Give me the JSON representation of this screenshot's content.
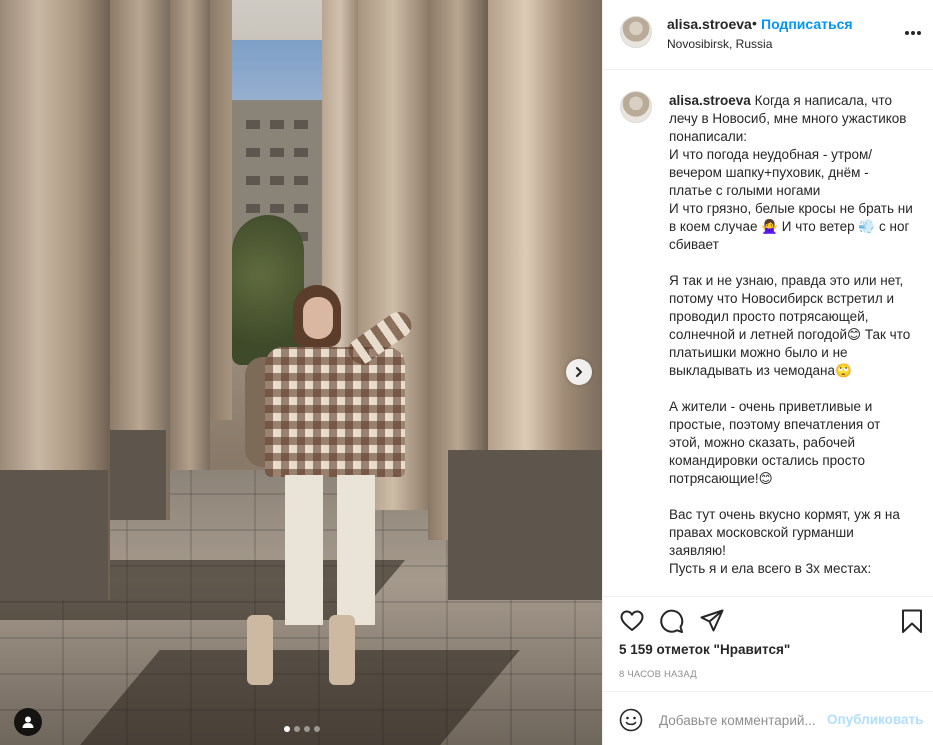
{
  "post": {
    "username": "alisa.stroeva",
    "separator": "•",
    "follow_label": "Подписаться",
    "location": "Novosibirsk, Russia",
    "more_icon": "more-horizontal-icon",
    "caption": {
      "username": "alisa.stroeva",
      "paragraphs": [
        "Когда я написала, что лечу в Новосиб, мне много ужастиков понаписали:",
        "И что погода неудобная - утром/вечером шапку+пуховик, днём - платье с голыми ногами",
        "И что грязно, белые кросы не брать ни в коем случае 🙅‍♀️ И что ветер 💨 с ног сбивает",
        "",
        "Я так и не узнаю, правда это или нет, потому что Новосибирск встретил и проводил просто потрясающей, солнечной и летней погодой😊 Так что платьишки можно было и не выкладывать из чемодана🙄",
        "",
        "А жители - очень приветливые и простые, поэтому впечатления от этой, можно сказать, рабочей командировки остались просто потрясающие!😊",
        "",
        "Вас тут очень вкусно кормят, уж я на правах московской гурманши заявляю!",
        "Пусть я и ела всего в 3х местах:"
      ]
    },
    "likes": "5 159 отметок \"Нравится\"",
    "time_ago": "8 ЧАСОВ НАЗАД",
    "comment": {
      "placeholder": "Добавьте комментарий...",
      "value": "",
      "publish_label": "Опубликовать"
    },
    "carousel": {
      "count": 4,
      "active_index": 0
    },
    "icons": {
      "like": "heart-icon",
      "comment": "comment-icon",
      "share": "paper-plane-icon",
      "save": "bookmark-icon",
      "next": "chevron-right-icon",
      "tag": "user-tag-icon",
      "emoji": "smiley-icon"
    }
  }
}
